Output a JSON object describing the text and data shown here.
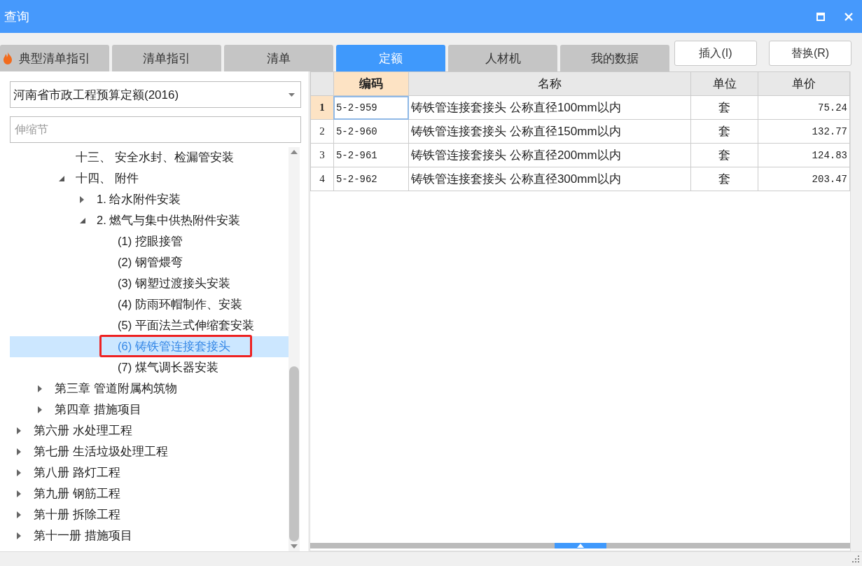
{
  "window": {
    "title": "查询"
  },
  "tabs": [
    {
      "label": "典型清单指引",
      "selected": false,
      "kind": "hot"
    },
    {
      "label": "清单指引",
      "selected": false
    },
    {
      "label": "清单",
      "selected": false
    },
    {
      "label": "定额",
      "selected": true
    },
    {
      "label": "人材机",
      "selected": false
    },
    {
      "label": "我的数据",
      "selected": false
    }
  ],
  "buttons": [
    "插入(I)",
    "替换(R)"
  ],
  "library": {
    "value": "河南省市政工程预算定额(2016)"
  },
  "search": {
    "placeholder": "伸缩节"
  },
  "tree": {
    "items": [
      {
        "children": [
          {
            "children": [
              {
                "label": "十三、 安全水封、检漏管安装",
                "selected": false
              },
              {
                "label": "十四、 附件",
                "selected": false,
                "expanded": true,
                "children": [
                  {
                    "label": "1. 给水附件安装",
                    "selected": false,
                    "expanded": false
                  },
                  {
                    "label": "2. 燃气与集中供热附件安装",
                    "selected": false,
                    "expanded": true,
                    "children": [
                      {
                        "label": "(1) 挖眼接管",
                        "selected": false
                      },
                      {
                        "label": "(2) 钢管煨弯",
                        "selected": false
                      },
                      {
                        "label": "(3) 钢塑过渡接头安装",
                        "selected": false
                      },
                      {
                        "label": "(4) 防雨环帽制作、安装",
                        "selected": false
                      },
                      {
                        "label": "(5) 平面法兰式伸缩套安装",
                        "selected": false
                      },
                      {
                        "label": "(6) 铸铁管连接套接头",
                        "selected": true
                      },
                      {
                        "label": "(7) 煤气调长器安装",
                        "selected": false
                      }
                    ]
                  }
                ]
              }
            ]
          },
          {
            "label": "第三章 管道附属构筑物",
            "selected": false,
            "expanded": false
          },
          {
            "label": "第四章 措施项目",
            "selected": false,
            "expanded": false
          }
        ]
      },
      {
        "label": "第六册 水处理工程",
        "selected": false,
        "expanded": false
      },
      {
        "label": "第七册 生活垃圾处理工程",
        "selected": false,
        "expanded": false
      },
      {
        "label": "第八册 路灯工程",
        "selected": false,
        "expanded": false
      },
      {
        "label": "第九册 钢筋工程",
        "selected": false,
        "expanded": false
      },
      {
        "label": "第十册 拆除工程",
        "selected": false,
        "expanded": false
      },
      {
        "label": "第十一册 措施项目",
        "selected": false,
        "expanded": false
      }
    ]
  },
  "table": {
    "columns": [
      {
        "label": "编码",
        "selected": true
      },
      {
        "label": "名称",
        "selected": false
      },
      {
        "label": "单位",
        "selected": false
      },
      {
        "label": "单价",
        "selected": false
      }
    ],
    "rows": [
      {
        "number": "1",
        "code": "5-2-959",
        "name": "铸铁管连接套接头  公称直径100mm以内",
        "unit": "套",
        "price": "75.24",
        "selected": true
      },
      {
        "number": "2",
        "code": "5-2-960",
        "name": "铸铁管连接套接头  公称直径150mm以内",
        "unit": "套",
        "price": "132.77",
        "selected": false
      },
      {
        "number": "3",
        "code": "5-2-961",
        "name": "铸铁管连接套接头  公称直径200mm以内",
        "unit": "套",
        "price": "124.83",
        "selected": false
      },
      {
        "number": "4",
        "code": "5-2-962",
        "name": "铸铁管连接套接头  公称直径300mm以内",
        "unit": "套",
        "price": "203.47",
        "selected": false
      }
    ]
  }
}
